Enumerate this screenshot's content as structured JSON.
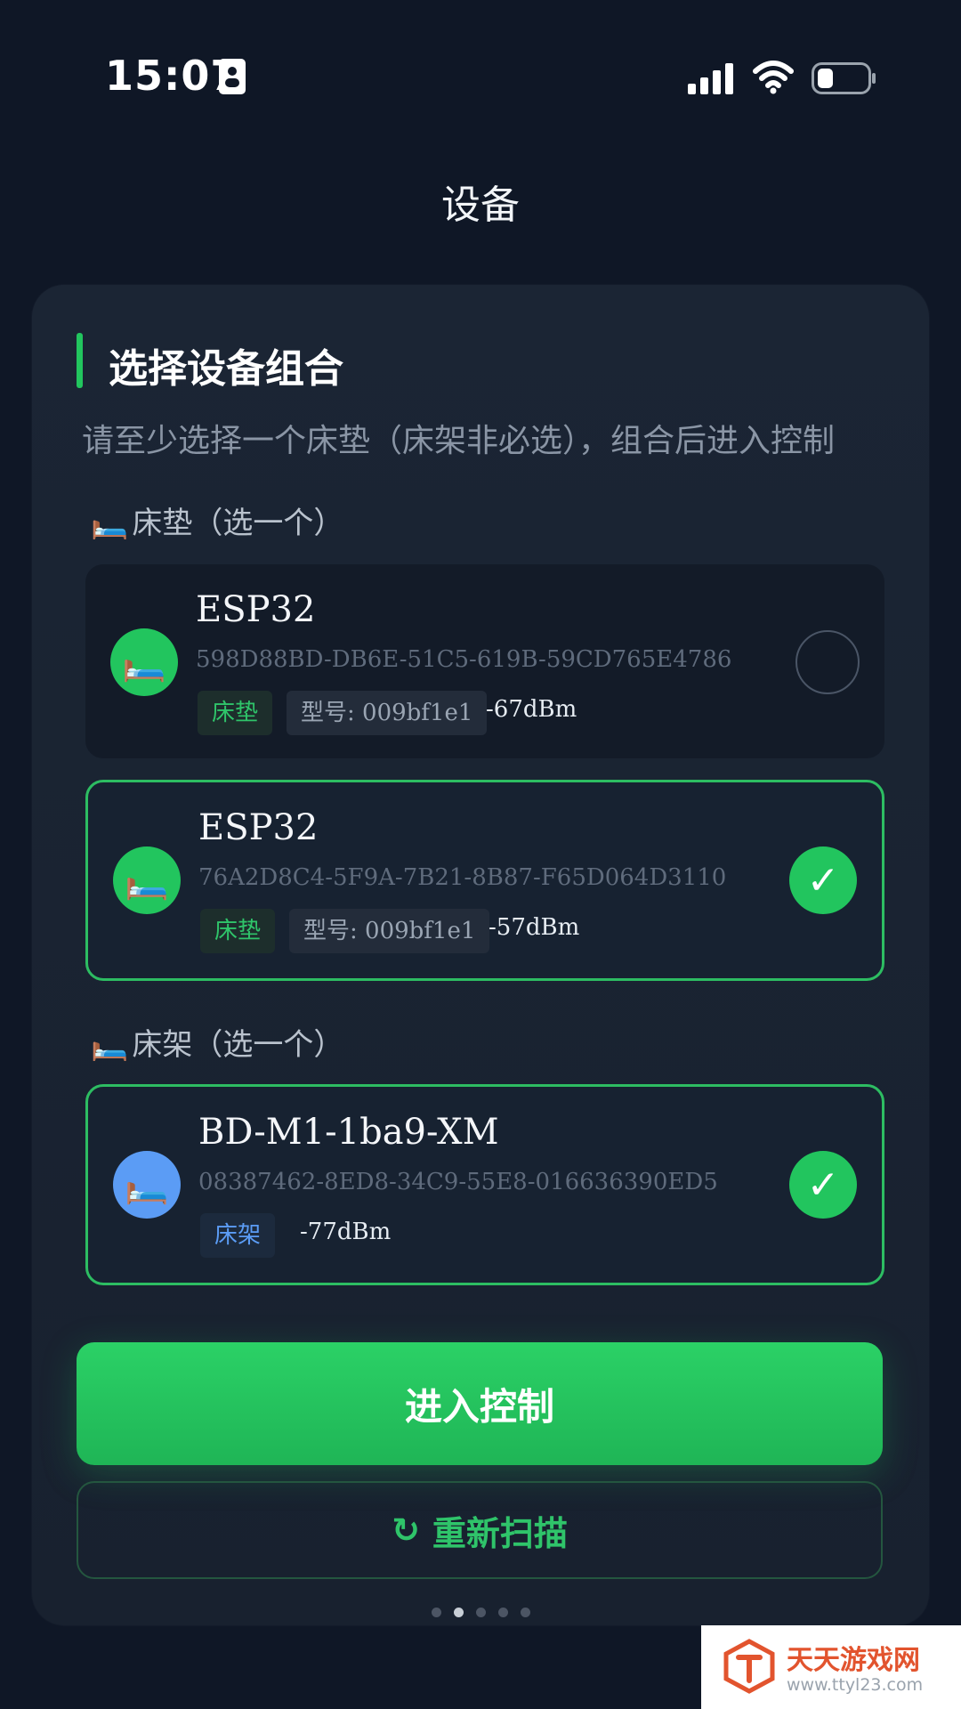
{
  "status_bar": {
    "time": "15:07"
  },
  "header": {
    "title": "设备"
  },
  "section": {
    "title": "选择设备组合",
    "description": "请至少选择一个床垫（床架非必选），组合后进入控制"
  },
  "mattress_group": {
    "icon": "🛏️",
    "label": "床垫（选一个）",
    "devices": [
      {
        "name": "ESP32",
        "uuid": "598D88BD-DB6E-51C5-619B-59CD765E4786",
        "type": "床垫",
        "model": "型号: 009bf1e1",
        "rssi": "-67dBm",
        "selected": false
      },
      {
        "name": "ESP32",
        "uuid": "76A2D8C4-5F9A-7B21-8B87-F65D064D3110",
        "type": "床垫",
        "model": "型号: 009bf1e1",
        "rssi": "-57dBm",
        "selected": true
      }
    ]
  },
  "frame_group": {
    "icon": "🛏️",
    "label": "床架（选一个）",
    "devices": [
      {
        "name": "BD-M1-1ba9-XM",
        "uuid": "08387462-8ED8-34C9-55E8-016636390ED5",
        "type": "床架",
        "rssi": "-77dBm",
        "selected": true
      }
    ]
  },
  "device_icon": "🛏️",
  "check_mark": "✓",
  "buttons": {
    "enter_control": "进入控制",
    "rescan_icon": "↻",
    "rescan": "重新扫描"
  },
  "pager": {
    "total": 5,
    "current": 2
  },
  "watermark": {
    "name": "天天游戏网",
    "url": "www.ttyl23.com"
  },
  "colors": {
    "accent": "#22c55e",
    "frame_accent": "#5b9cf5",
    "background": "#0f1726"
  }
}
